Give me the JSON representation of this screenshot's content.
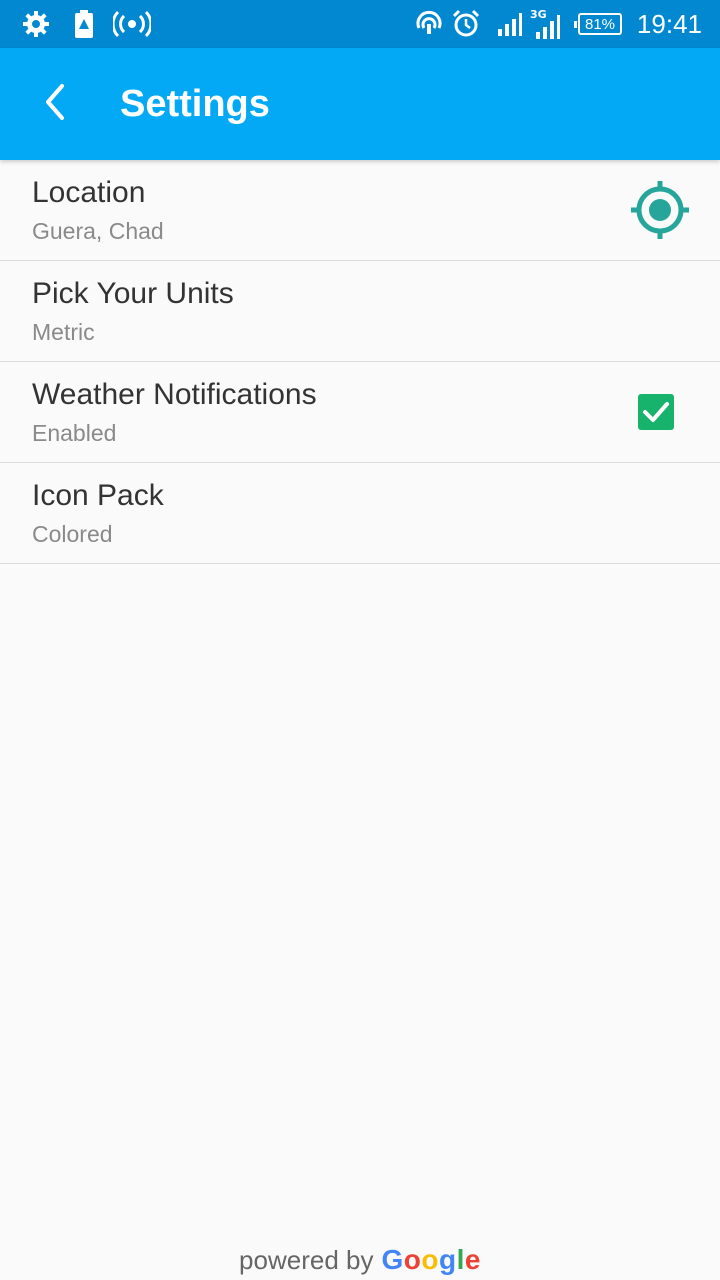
{
  "status_bar": {
    "battery": "81%",
    "network": "3G",
    "time": "19:41",
    "icons": [
      "settings-cog-icon",
      "battery-warning-icon",
      "hotspot-icon",
      "nfc-icon",
      "alarm-icon",
      "signal-icon",
      "signal-3g-icon"
    ]
  },
  "app_bar": {
    "title": "Settings",
    "back_icon": "chevron-left-icon"
  },
  "settings": [
    {
      "title": "Location",
      "subtitle": "Guera, Chad",
      "action": "gps-target-icon"
    },
    {
      "title": "Pick Your Units",
      "subtitle": "Metric"
    },
    {
      "title": "Weather Notifications",
      "subtitle": "Enabled",
      "action": "checkbox",
      "checked": true
    },
    {
      "title": "Icon Pack",
      "subtitle": "Colored"
    }
  ],
  "footer": {
    "prefix": "powered by",
    "brand": "Google"
  },
  "colors": {
    "status_bar": "#0288d1",
    "app_bar": "#03a9f4",
    "accent_teal": "#26a69a",
    "checkbox": "#17b36c"
  }
}
